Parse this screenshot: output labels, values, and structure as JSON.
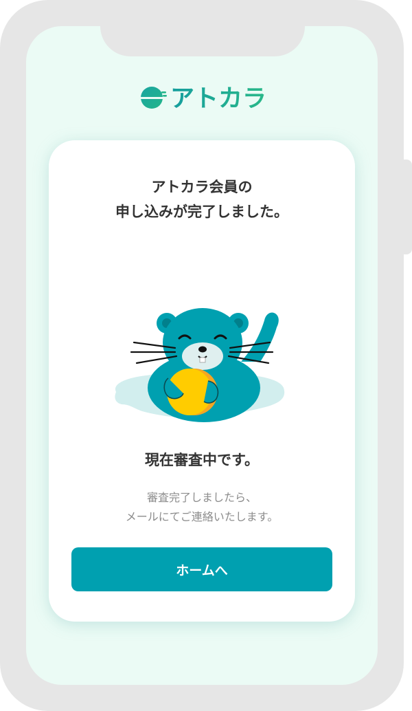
{
  "app": {
    "logo_text": "アトカラ",
    "brand_color": "#00a0b0",
    "logo_icon": "half-circle-logo-icon"
  },
  "card": {
    "title_line1": "アトカラ会員の",
    "title_line2": "申し込みが完了しました。",
    "mascot": "otter-holding-coin-illustration",
    "status": "現在審査中です。",
    "message_line1": "審査完了しましたら、",
    "message_line2": "メールにてご連絡いたします。",
    "button_label": "ホームへ"
  },
  "colors": {
    "screen_bg": "#ebfbf5",
    "card_bg": "#ffffff",
    "button_bg": "#00a0b0",
    "button_text": "#ffffff",
    "title_text": "#333333",
    "sub_text": "#8c8c8c",
    "otter": "#00a0b0",
    "coin": "#ffcc00"
  }
}
